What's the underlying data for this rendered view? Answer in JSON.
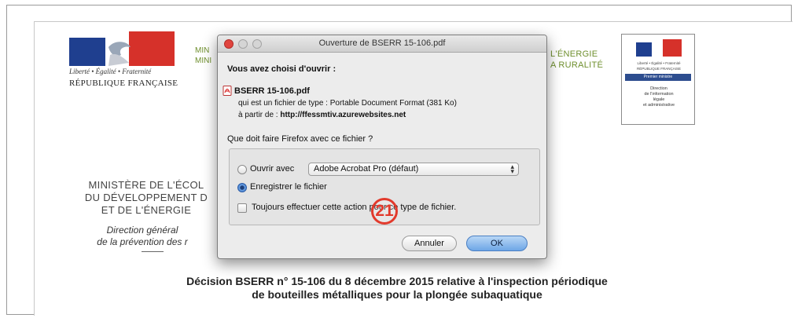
{
  "document": {
    "republic_motto": "Liberté • Égalité • Fraternité",
    "republic_name": "RÉPUBLIQUE FRANÇAISE",
    "header_ministry_visible": [
      "MIN",
      "MINI"
    ],
    "header_right_visible": [
      "L'ÉNERGIE",
      "A RURALITÉ"
    ],
    "right_logo": {
      "line1": "Liberté • Égalité • Fraternité",
      "line2": "RÉPUBLIQUE FRANÇAISE",
      "band": "Premier ministre",
      "direction": [
        "Direction",
        "de l'information",
        "légale",
        "et administrative"
      ]
    },
    "ministry_visible": [
      "MINISTÈRE DE L'ÉCOL",
      "DU DÉVELOPPEMENT D",
      "ET DE L'ÉNERGIE"
    ],
    "direction_visible": [
      "Direction général",
      "de la prévention des r"
    ],
    "decision_title": [
      "Décision BSERR n° 15-106 du 8 décembre 2015 relative à l'inspection périodique",
      "de bouteilles métalliques pour la plongée subaquatique"
    ]
  },
  "dialog": {
    "title": "Ouverture de BSERR 15-106.pdf",
    "heading": "Vous avez choisi d'ouvrir :",
    "file_name": "BSERR 15-106.pdf",
    "file_type_line": "qui est un fichier de type : Portable Document Format (381 Ko)",
    "from_label": "à partir de : ",
    "from_url": "http://ffessmtiv.azurewebsites.net",
    "question": "Que doit faire Firefox avec ce fichier ?",
    "option_open_label": "Ouvrir avec",
    "open_with_app": "Adobe Acrobat Pro (défaut)",
    "option_save_label": "Enregistrer le fichier",
    "always_label": "Toujours effectuer cette action pour ce type de fichier.",
    "selected_option": "save",
    "cancel_label": "Annuler",
    "ok_label": "OK",
    "icons": [
      "close-icon",
      "minimize-icon",
      "maximize-icon",
      "pdf-file-icon",
      "updown-arrows-icon"
    ]
  },
  "annotation": {
    "step_number": "21",
    "color": "#e23a2c"
  },
  "colors": {
    "ministry_green": "#6f8f2e",
    "ok_blue": "#6ea6e6",
    "flag_blue": "#1f3f8f",
    "flag_red": "#d6312a"
  }
}
